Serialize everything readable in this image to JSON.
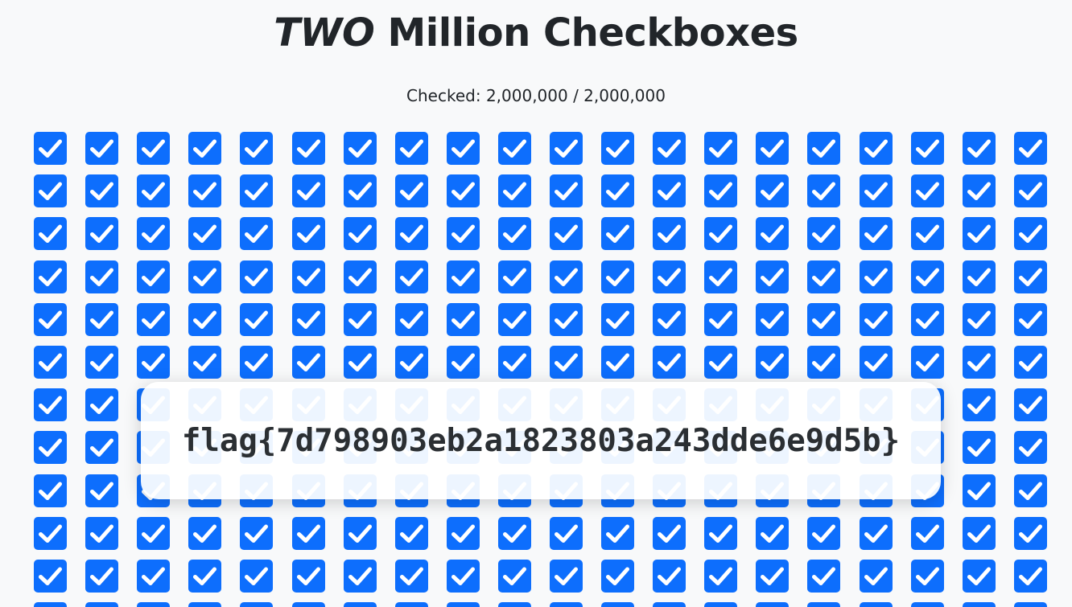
{
  "header": {
    "title_emphasis": "TWO",
    "title_rest": " Million Checkboxes"
  },
  "status": {
    "checked_label": "Checked: 2,000,000 / 2,000,000"
  },
  "grid": {
    "checked": true,
    "accent_color": "#0d6efd",
    "check_icon": "checkmark-icon"
  },
  "overlay": {
    "flag": "flag{7d798903eb2a1823803a243dde6e9d5b}"
  }
}
